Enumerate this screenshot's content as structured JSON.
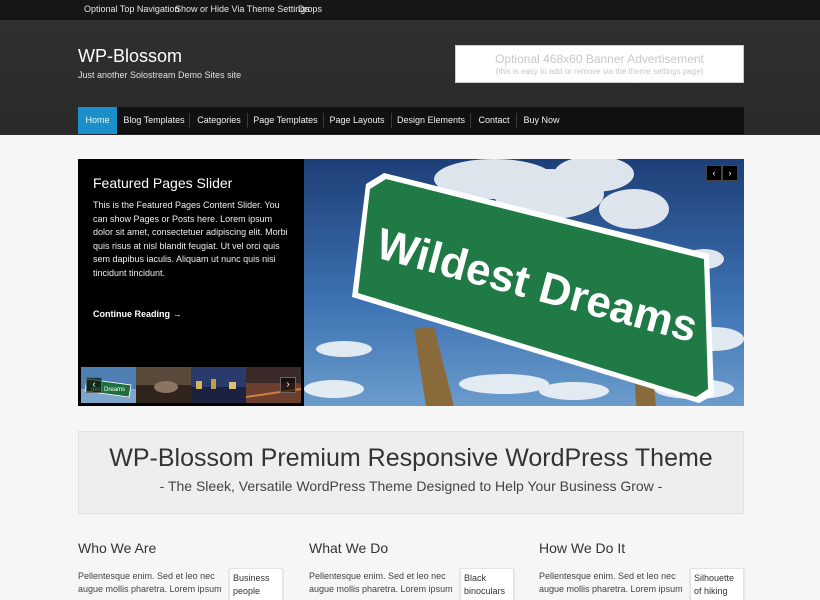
{
  "top_nav": {
    "items": [
      "Optional Top Navigation",
      "Show or Hide Via Theme Settings",
      "Drops"
    ]
  },
  "header": {
    "site_title": "WP-Blossom",
    "tagline": "Just another Solostream Demo Sites site",
    "banner_line1": "Optional 468x60 Banner Advertisement",
    "banner_line2": "(this is easy to add or remove via the theme settings page)"
  },
  "main_nav": {
    "items": [
      "Home",
      "Blog Templates",
      "Categories",
      "Page Templates",
      "Page Layouts",
      "Design Elements",
      "Contact",
      "Buy Now"
    ],
    "active": "Home",
    "active_color": "#1b8fc9"
  },
  "slider": {
    "title": "Featured Pages Slider",
    "body": "This is the Featured Pages Content Slider. You can show Pages or Posts here. Lorem ipsum dolor sit amet, consectetuer adipiscing elit. Morbi quis risus at nisl blandit feugiat. Ut vel orci quis sem dapibus iaculis. Aliquam ut nunc quis nisi tincidunt tincidunt.",
    "continue_label": "Continue Reading →",
    "image_sign_text": "Wildest Dreams",
    "thumb_sign_text": "dest Dreams",
    "prev_icon": "‹",
    "next_icon": "›"
  },
  "promo": {
    "title": "WP-Blossom Premium Responsive WordPress Theme",
    "subtitle": "- The Sleek, Versatile WordPress Theme Designed to Help Your Business Grow -"
  },
  "columns": [
    {
      "heading": "Who We Are",
      "text": "Pellentesque enim. Sed et leo nec augue mollis pharetra. Lorem ipsum",
      "card": "Business people"
    },
    {
      "heading": "What We Do",
      "text": "Pellentesque enim. Sed et leo nec augue mollis pharetra. Lorem ipsum",
      "card": "Black binoculars"
    },
    {
      "heading": "How We Do It",
      "text": "Pellentesque enim. Sed et leo nec augue mollis pharetra. Lorem ipsum",
      "card": "Silhouette of hiking man"
    }
  ]
}
